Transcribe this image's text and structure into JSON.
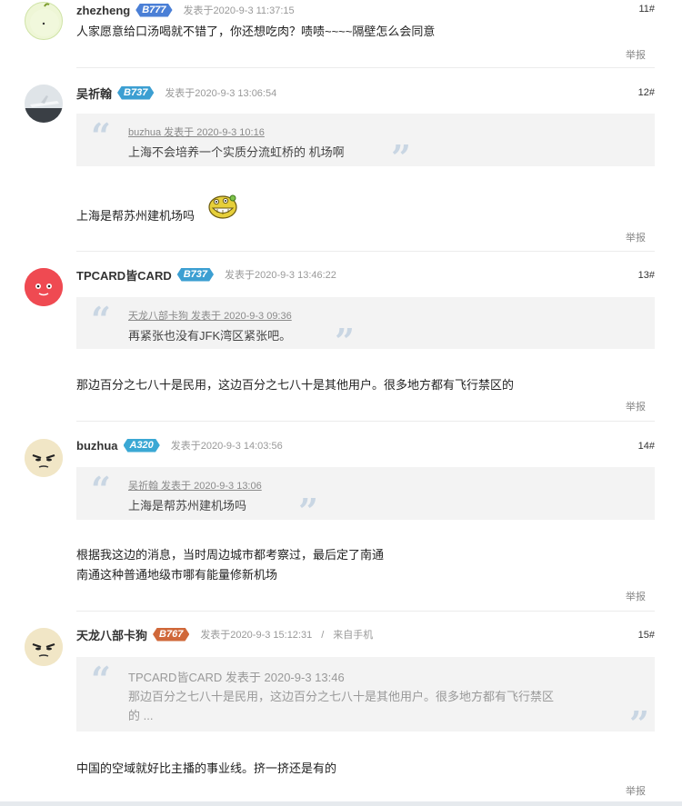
{
  "posts": [
    {
      "username": "zhezheng",
      "badge": "B777",
      "badge_color": "#4a7fd6",
      "timestamp": "发表于2020-9-3 11:37:15",
      "floor": "11#",
      "content_lines": [
        "人家愿意给口汤喝就不错了，你还想吃肉？啧啧~~~~隔壁怎么会同意"
      ],
      "report": "举报"
    },
    {
      "username": "吴祈翰",
      "badge": "B737",
      "badge_color": "#3c9fd2",
      "timestamp": "发表于2020-9-3 13:06:54",
      "floor": "12#",
      "quote": {
        "source": "buzhua 发表于 2020-9-3 10:16",
        "text": "上海不会培养一个实质分流虹桥的 机场啊"
      },
      "content_lines": [
        "上海是帮苏州建机场吗"
      ],
      "emoji": "grinning-emoticon",
      "report": "举报"
    },
    {
      "username": "TPCARD皆CARD",
      "badge": "B737",
      "badge_color": "#3c9fd2",
      "timestamp": "发表于2020-9-3 13:46:22",
      "floor": "13#",
      "quote": {
        "source": "天龙八部卡狗 发表于 2020-9-3 09:36",
        "text": "再紧张也没有JFK湾区紧张吧。"
      },
      "content_lines": [
        "那边百分之七八十是民用，这边百分之七八十是其他用户。很多地方都有飞行禁区的"
      ],
      "report": "举报"
    },
    {
      "username": "buzhua",
      "badge": "A320",
      "badge_color": "#3ba8d4",
      "timestamp": "发表于2020-9-3 14:03:56",
      "floor": "14#",
      "quote": {
        "source": "吴祈翰 发表于 2020-9-3 13:06",
        "text": "上海是帮苏州建机场吗"
      },
      "content_lines": [
        "根据我这边的消息，当时周边城市都考察过，最后定了南通",
        "南通这种普通地级市哪有能量修新机场"
      ],
      "report": "举报"
    },
    {
      "username": "天龙八部卡狗",
      "badge": "B767",
      "badge_color": "#d0683a",
      "timestamp": "发表于2020-9-3 15:12:31",
      "separator": "/",
      "device": "来自手机",
      "floor": "15#",
      "quote": {
        "source": "TPCARD皆CARD 发表于 2020-9-3 13:46",
        "text_lines": [
          "那边百分之七八十是民用，这边百分之七八十是其他用户。很多地方都有飞行禁区",
          "的 ..."
        ]
      },
      "content_lines": [
        "中国的空域就好比主播的事业线。挤一挤还是有的"
      ],
      "report": "举报"
    }
  ]
}
